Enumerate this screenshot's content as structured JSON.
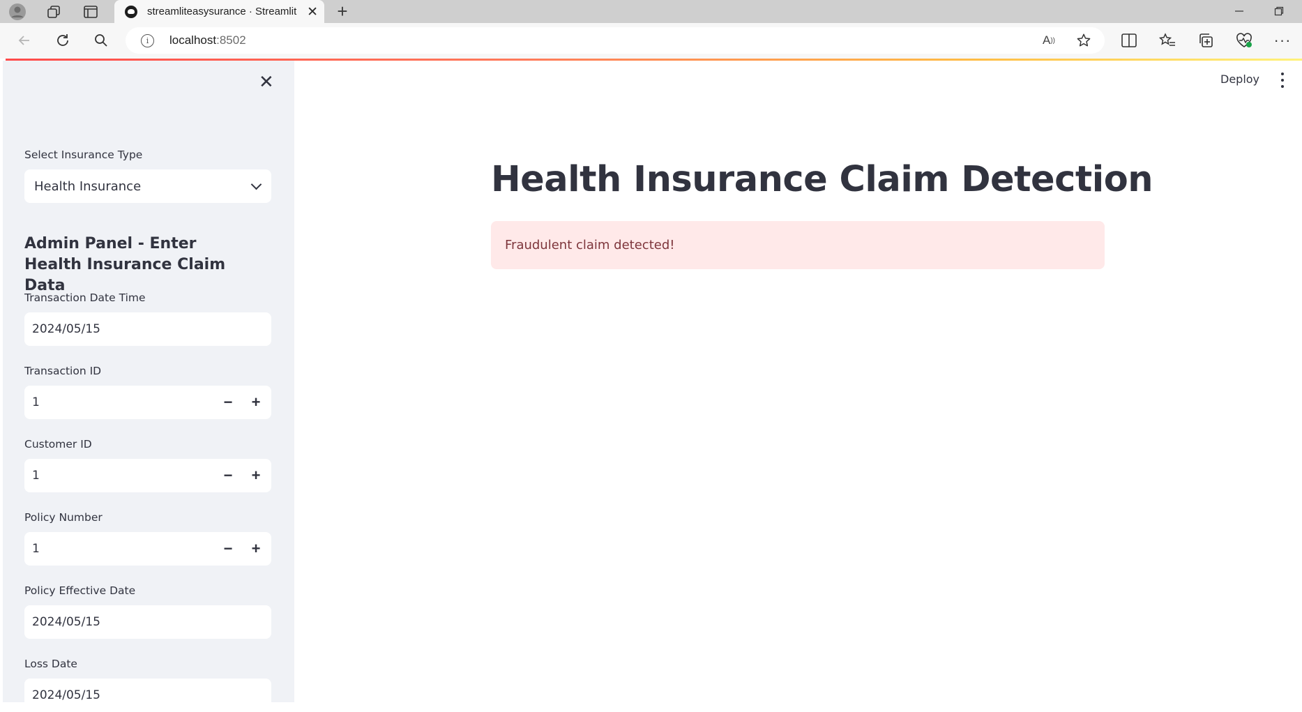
{
  "browser": {
    "tab_title": "streamliteasysurance · Streamlit",
    "url_host": "localhost",
    "url_port": ":8502"
  },
  "sidebar": {
    "insurance_type_label": "Select Insurance Type",
    "insurance_type_value": "Health Insurance",
    "subheader": "Admin Panel - Enter Health Insurance Claim Data",
    "fields": [
      {
        "label": "Transaction Date Time",
        "value": "2024/05/15"
      },
      {
        "label": "Transaction ID",
        "value": "1"
      },
      {
        "label": "Customer ID",
        "value": "1"
      },
      {
        "label": "Policy Number",
        "value": "1"
      },
      {
        "label": "Policy Effective Date",
        "value": "2024/05/15"
      },
      {
        "label": "Loss Date",
        "value": "2024/05/15"
      }
    ],
    "stepper_minus": "−",
    "stepper_plus": "+"
  },
  "header": {
    "deploy_label": "Deploy"
  },
  "main": {
    "title": "Health Insurance Claim Detection",
    "alert_text": "Fraudulent claim detected!"
  },
  "colors": {
    "sidebar_bg": "#f0f2f6",
    "text": "#31333f",
    "alert_bg": "#ffe9e9",
    "alert_text": "#7d353b"
  }
}
